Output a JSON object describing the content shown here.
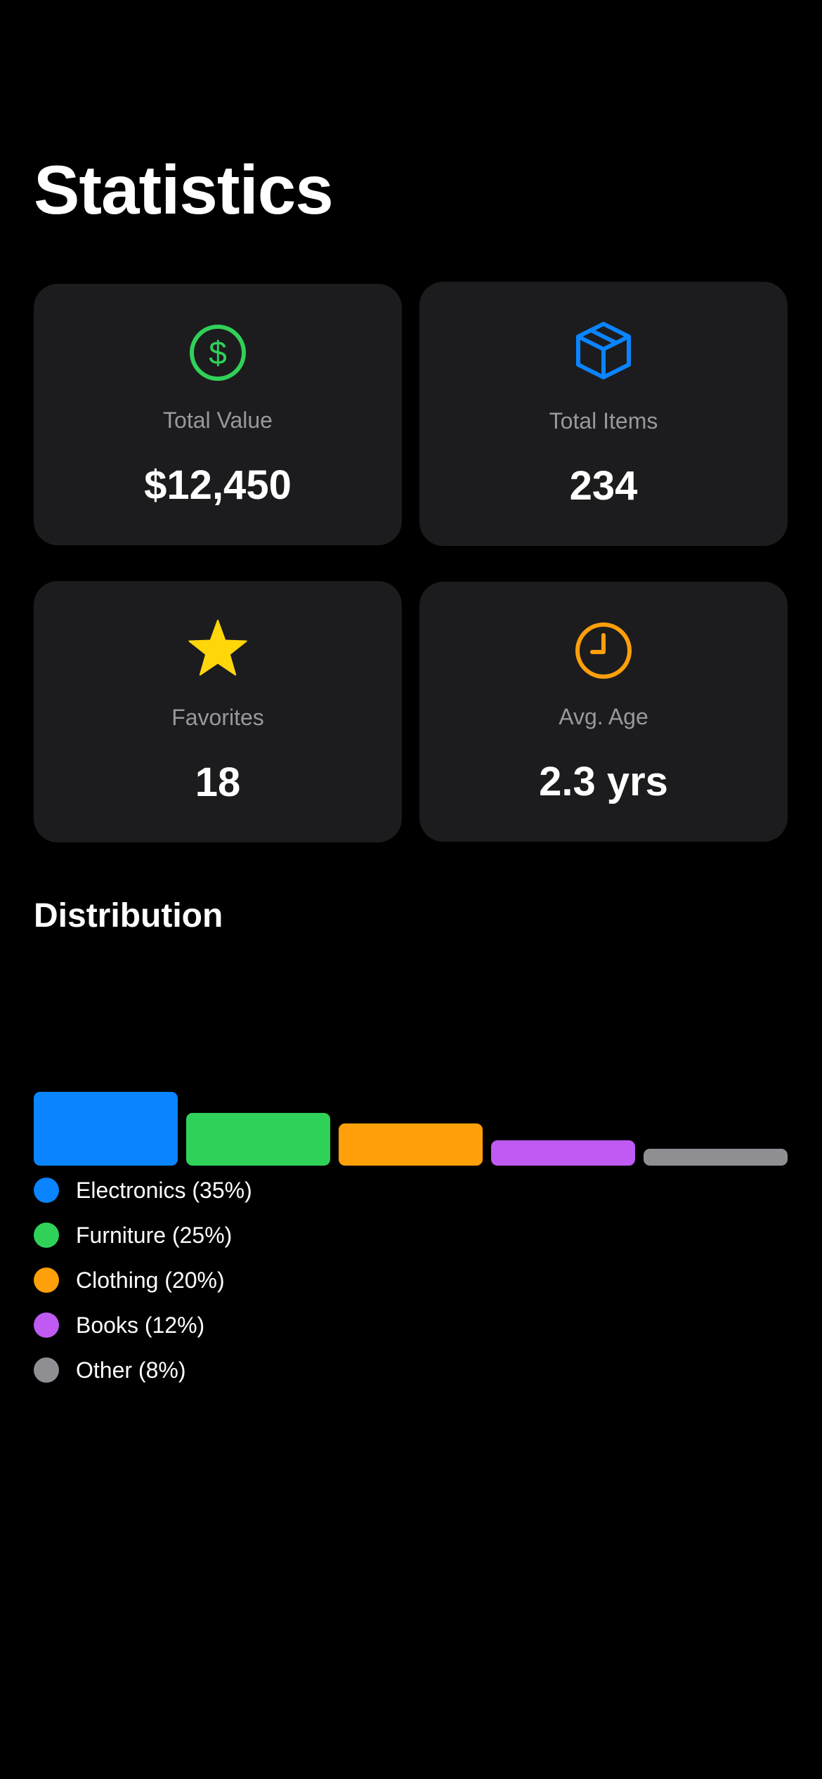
{
  "page": {
    "title": "Statistics"
  },
  "stats": [
    {
      "icon": "dollar-circle-icon",
      "label": "Total Value",
      "value": "$12,450",
      "color": "#30d158"
    },
    {
      "icon": "box-icon",
      "label": "Total Items",
      "value": "234",
      "color": "#0a84ff"
    },
    {
      "icon": "star-icon",
      "label": "Favorites",
      "value": "18",
      "color": "#ffd60a"
    },
    {
      "icon": "clock-icon",
      "label": "Avg. Age",
      "value": "2.3 yrs",
      "color": "#ff9f0a"
    }
  ],
  "distribution": {
    "title": "Distribution",
    "legend": [
      {
        "label": "Electronics (35%)",
        "color": "#0a84ff"
      },
      {
        "label": "Furniture (25%)",
        "color": "#30d158"
      },
      {
        "label": "Clothing (20%)",
        "color": "#ff9f0a"
      },
      {
        "label": "Books (12%)",
        "color": "#bf5af2"
      },
      {
        "label": "Other (8%)",
        "color": "#8e8e93"
      }
    ]
  },
  "chart_data": {
    "type": "bar",
    "categories": [
      "Electronics",
      "Furniture",
      "Clothing",
      "Books",
      "Other"
    ],
    "values": [
      35,
      25,
      20,
      12,
      8
    ],
    "colors": [
      "#0a84ff",
      "#30d158",
      "#ff9f0a",
      "#bf5af2",
      "#8e8e93"
    ],
    "title": "Distribution",
    "xlabel": "",
    "ylabel": "",
    "ylim": [
      0,
      100
    ],
    "grid": false,
    "legend": "bottom-left"
  }
}
